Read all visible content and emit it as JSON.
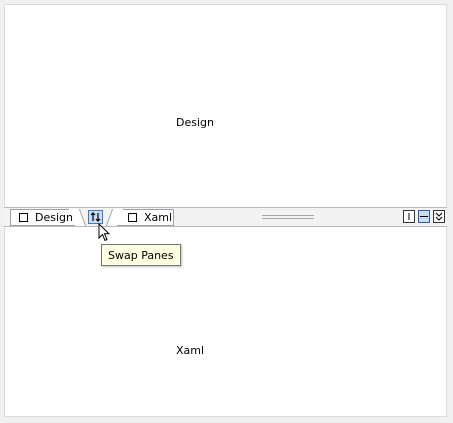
{
  "panes": {
    "design": {
      "label": "Design"
    },
    "xaml": {
      "label": "Xaml"
    }
  },
  "splitbar": {
    "tabs": [
      {
        "label": "Design"
      },
      {
        "label": "Xaml"
      }
    ],
    "swap_button": {
      "icon": "swap-arrows-icon"
    },
    "right_buttons": [
      {
        "icon": "vertical-split-icon"
      },
      {
        "icon": "horizontal-split-icon"
      },
      {
        "icon": "collapse-pane-icon"
      }
    ]
  },
  "tooltip": {
    "text": "Swap Panes"
  },
  "colors": {
    "accent": "#3d7bc6",
    "accent_fill": "#c8dcf2",
    "tooltip_bg": "#ffffe1"
  }
}
